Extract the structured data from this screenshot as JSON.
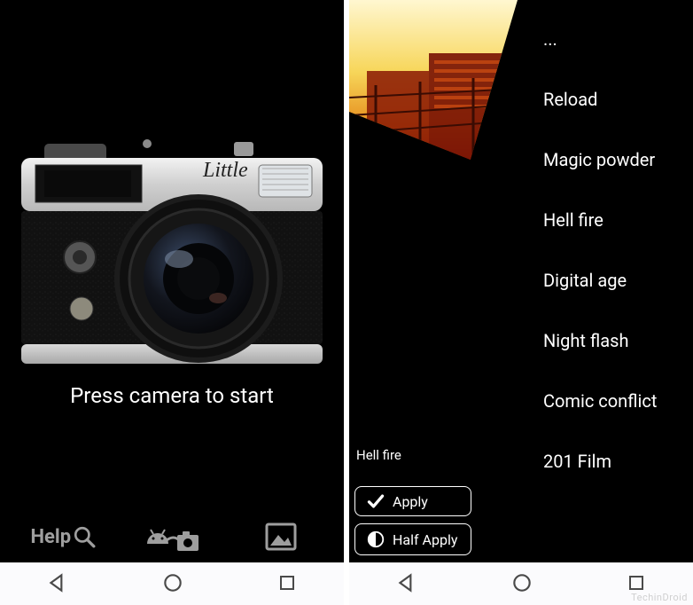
{
  "left": {
    "camera_brand": "Little",
    "prompt": "Press camera to start",
    "toolbar": {
      "help_label": "Help"
    }
  },
  "right": {
    "selected_filter_label": "Hell fire",
    "buttons": {
      "apply": "Apply",
      "half_apply": "Half Apply"
    },
    "filters": [
      "...",
      "Reload",
      "Magic powder",
      "Hell fire",
      "Digital age",
      "Night flash",
      "Comic conflict",
      "201 Film"
    ]
  },
  "watermark": "TechinDroid"
}
